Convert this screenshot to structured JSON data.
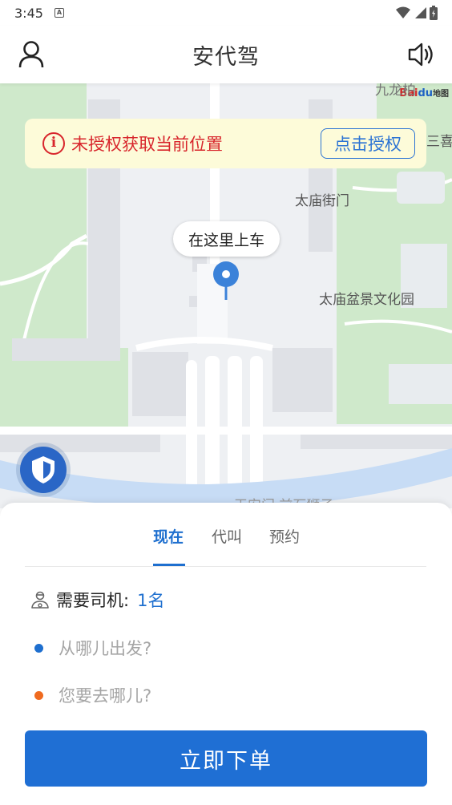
{
  "status_bar": {
    "time": "3:45",
    "notification_icon": "A"
  },
  "header": {
    "title": "安代驾",
    "user_icon": "person-icon",
    "speaker_icon": "speaker-icon"
  },
  "map": {
    "auth_banner": {
      "message": "未授权获取当前位置",
      "button": "点击授权",
      "icon": "info-icon"
    },
    "pickup_label": "在这里上车",
    "poi_labels": {
      "taimiao_street": "太庙街门",
      "bonsai_garden": "太庙盆景文化园",
      "top_label": "九龙柏",
      "right_label": "三喜",
      "bottom_label": "天安门·前石狮子"
    },
    "baidu_logo": {
      "bai": "Bai",
      "du": "du",
      "map": "地图"
    },
    "colors": {
      "green": "#cfe9cb",
      "water": "#c7dcf5",
      "road": "#ffffff",
      "ground": "#eef0f3",
      "building": "#dfe1e6"
    }
  },
  "panel": {
    "tabs": [
      {
        "label": "现在",
        "active": true
      },
      {
        "label": "代叫",
        "active": false
      },
      {
        "label": "预约",
        "active": false
      }
    ],
    "driver": {
      "label": "需要司机:",
      "count": "1名"
    },
    "from_placeholder": "从哪儿出发?",
    "to_placeholder": "您要去哪儿?",
    "order_button": "立即下单",
    "colors": {
      "accent": "#1f6fd4",
      "from_dot": "#1e6fcf",
      "to_dot": "#ef6a1f"
    }
  }
}
